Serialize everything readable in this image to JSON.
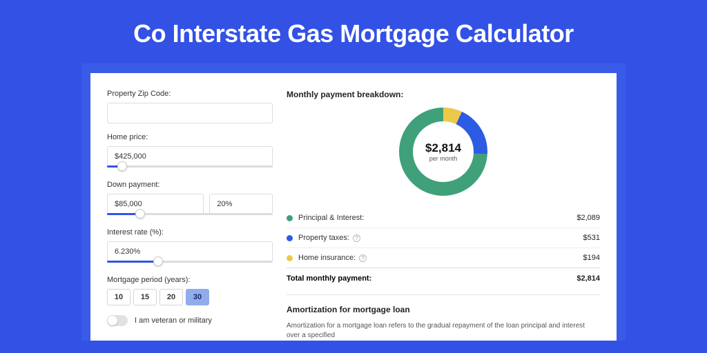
{
  "title": "Co Interstate Gas Mortgage Calculator",
  "form": {
    "zip_label": "Property Zip Code:",
    "zip_value": "",
    "home_price_label": "Home price:",
    "home_price_value": "$425,000",
    "down_payment_label": "Down payment:",
    "down_payment_amount": "$85,000",
    "down_payment_percent": "20%",
    "interest_label": "Interest rate (%):",
    "interest_value": "6.230%",
    "period_label": "Mortgage period (years):",
    "periods": [
      "10",
      "15",
      "20",
      "30"
    ],
    "period_selected": "30",
    "veteran_label": "I am veteran or military",
    "veteran_on": false
  },
  "breakdown": {
    "title": "Monthly payment breakdown:",
    "donut_amount": "$2,814",
    "donut_sub": "per month",
    "rows": [
      {
        "label": "Principal & Interest:",
        "value": "$2,089",
        "info": false,
        "color": "green"
      },
      {
        "label": "Property taxes:",
        "value": "$531",
        "info": true,
        "color": "blue"
      },
      {
        "label": "Home insurance:",
        "value": "$194",
        "info": true,
        "color": "yellow"
      }
    ],
    "total_label": "Total monthly payment:",
    "total_value": "$2,814"
  },
  "amort": {
    "title": "Amortization for mortgage loan",
    "text": "Amortization for a mortgage loan refers to the gradual repayment of the loan principal and interest over a specified"
  },
  "chart_data": {
    "type": "pie",
    "title": "Monthly payment breakdown",
    "categories": [
      "Principal & Interest",
      "Property taxes",
      "Home insurance"
    ],
    "values": [
      2089,
      531,
      194
    ],
    "colors": [
      "#3fa07a",
      "#2d5be3",
      "#edc949"
    ],
    "total": 2814,
    "center_label": "$2,814 per month"
  }
}
